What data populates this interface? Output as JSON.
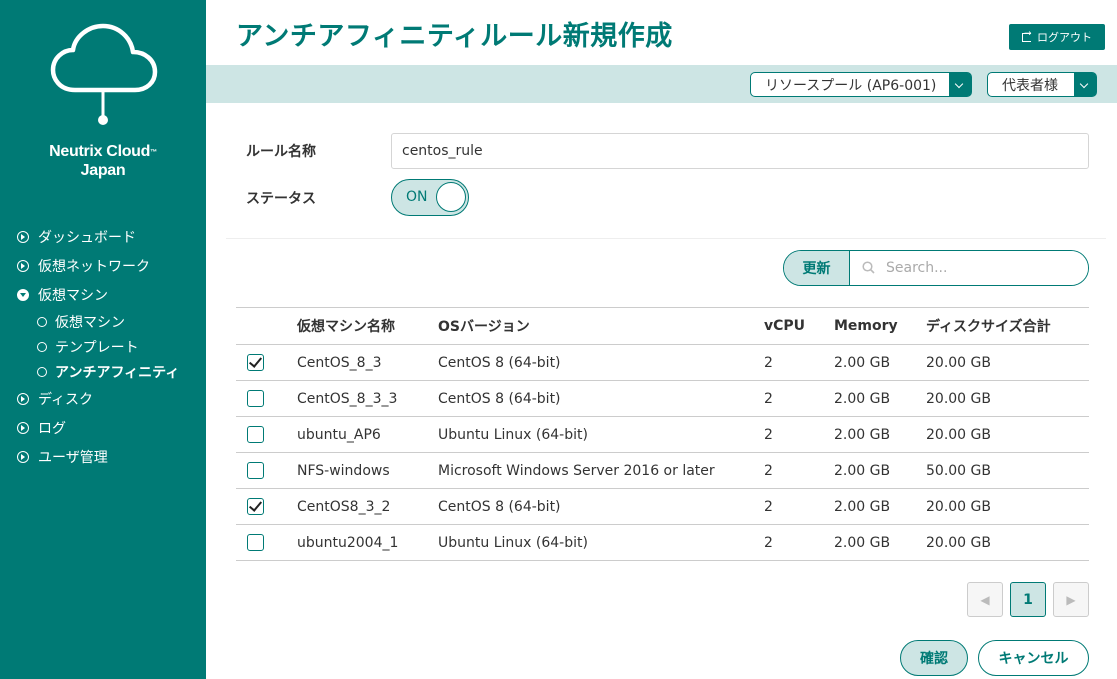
{
  "sidebar": {
    "brand_name": "Neutrix Cloud",
    "brand_tm": "™",
    "brand_sub": "Japan",
    "items": [
      {
        "label": "ダッシュボード"
      },
      {
        "label": "仮想ネットワーク"
      },
      {
        "label": "仮想マシン",
        "expanded": true,
        "children": [
          {
            "label": "仮想マシン"
          },
          {
            "label": "テンプレート"
          },
          {
            "label": "アンチアフィニティ",
            "active": true
          }
        ]
      },
      {
        "label": "ディスク"
      },
      {
        "label": "ログ"
      },
      {
        "label": "ユーザ管理"
      }
    ]
  },
  "header": {
    "title": "アンチアフィニティルール新規作成",
    "logout_label": "ログアウト",
    "pool_select": "リソースプール (AP6-001)",
    "user_select": "代表者様"
  },
  "form": {
    "rule_name_label": "ルール名称",
    "rule_name_value": "centos_rule",
    "status_label": "ステータス",
    "status_value": "ON"
  },
  "search": {
    "refresh_label": "更新",
    "placeholder": "Search..."
  },
  "table": {
    "columns": [
      "仮想マシン名称",
      "OSバージョン",
      "vCPU",
      "Memory",
      "ディスクサイズ合計"
    ],
    "rows": [
      {
        "checked": true,
        "name": "CentOS_8_3",
        "os": "CentOS 8 (64-bit)",
        "vcpu": "2",
        "memory": "2.00 GB",
        "disk": "20.00 GB"
      },
      {
        "checked": false,
        "name": "CentOS_8_3_3",
        "os": "CentOS 8 (64-bit)",
        "vcpu": "2",
        "memory": "2.00 GB",
        "disk": "20.00 GB"
      },
      {
        "checked": false,
        "name": "ubuntu_AP6",
        "os": "Ubuntu Linux (64-bit)",
        "vcpu": "2",
        "memory": "2.00 GB",
        "disk": "20.00 GB"
      },
      {
        "checked": false,
        "name": "NFS-windows",
        "os": "Microsoft Windows Server 2016 or later",
        "vcpu": "2",
        "memory": "2.00 GB",
        "disk": "50.00 GB"
      },
      {
        "checked": true,
        "name": "CentOS8_3_2",
        "os": "CentOS 8 (64-bit)",
        "vcpu": "2",
        "memory": "2.00 GB",
        "disk": "20.00 GB"
      },
      {
        "checked": false,
        "name": "ubuntu2004_1",
        "os": "Ubuntu Linux (64-bit)",
        "vcpu": "2",
        "memory": "2.00 GB",
        "disk": "20.00 GB"
      }
    ]
  },
  "pagination": {
    "prev": "◀",
    "current": "1",
    "next": "▶"
  },
  "actions": {
    "confirm_label": "確認",
    "cancel_label": "キャンセル"
  },
  "colors": {
    "primary": "#007a75",
    "light": "#cde5e4"
  }
}
